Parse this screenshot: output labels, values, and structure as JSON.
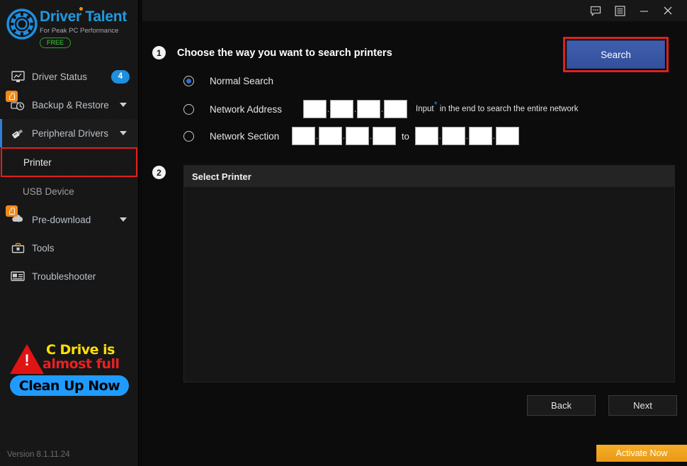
{
  "app": {
    "brand_primary": "Driver",
    "brand_secondary": "Talent",
    "tagline": "For Peak PC Performance",
    "edition": "FREE",
    "version": "Version 8.1.11.24",
    "accent_blue": "#1f9ae0",
    "highlight_red": "#e02020",
    "lock_orange": "#f08a1b"
  },
  "titlebar": {
    "buttons": [
      {
        "name": "feedback-icon",
        "label": "Feedback"
      },
      {
        "name": "menu-icon",
        "label": "Menu"
      },
      {
        "name": "minimize-icon",
        "label": "Minimize"
      },
      {
        "name": "close-icon",
        "label": "Close"
      }
    ]
  },
  "sidebar": {
    "items": [
      {
        "label": "Driver Status",
        "icon": "monitor-icon",
        "badge": "4",
        "locked": false,
        "expandable": false
      },
      {
        "label": "Backup & Restore",
        "icon": "backup-clock-icon",
        "badge": null,
        "locked": true,
        "expandable": true
      },
      {
        "label": "Peripheral Drivers",
        "icon": "usb-stick-icon",
        "badge": null,
        "locked": false,
        "expandable": true,
        "active": true
      },
      {
        "label": "Pre-download",
        "icon": "cloud-download-icon",
        "badge": null,
        "locked": true,
        "expandable": true
      },
      {
        "label": "Tools",
        "icon": "toolbox-icon",
        "badge": null,
        "locked": false,
        "expandable": false
      },
      {
        "label": "Troubleshooter",
        "icon": "troubleshooter-icon",
        "badge": null,
        "locked": false,
        "expandable": false
      }
    ],
    "subitems": [
      {
        "label": "Printer",
        "highlighted": true
      },
      {
        "label": "USB Device",
        "highlighted": false
      }
    ]
  },
  "promo": {
    "line1": "C Drive is",
    "line2": "almost full",
    "button": "Clean Up Now",
    "line1_color": "#ffe000",
    "line2_color": "#ec2020",
    "button_color": "#1f9bff"
  },
  "main": {
    "step1_number": "1",
    "step1_title": "Choose the way you want to search printers",
    "search_button": "Search",
    "options": [
      {
        "label": "Normal Search",
        "selected": true
      },
      {
        "label": "Network Address",
        "selected": false
      },
      {
        "label": "Network Section",
        "selected": false
      }
    ],
    "network_address": {
      "octets": [
        "",
        "",
        "",
        ""
      ],
      "separator": ".",
      "hint_before": "Input",
      "hint_star": "*",
      "hint_after": "in the end to search the entire network"
    },
    "network_section": {
      "from_octets": [
        "",
        "",
        "",
        ""
      ],
      "to_octets": [
        "",
        "",
        "",
        ""
      ],
      "to_label": "to",
      "separator": "."
    },
    "step2_number": "2",
    "printer_panel_title": "Select Printer",
    "printer_list": [],
    "back_button": "Back",
    "next_button": "Next",
    "activate_button": "Activate Now"
  }
}
